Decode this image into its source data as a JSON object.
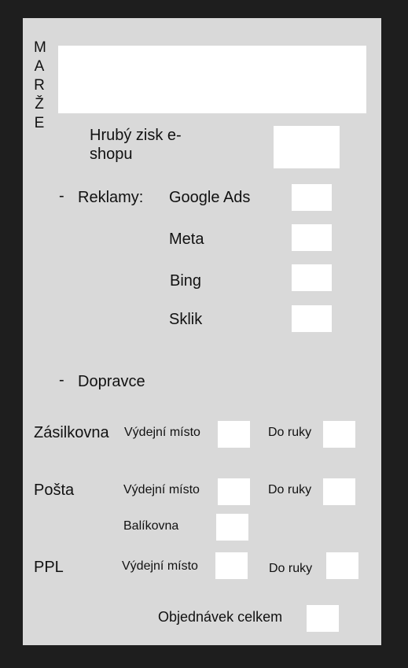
{
  "form": {
    "marze_letters": [
      "M",
      "A",
      "R",
      "Ž",
      "E"
    ],
    "hruby_zisk_line1": "Hrubý zisk e-",
    "hruby_zisk_line2": "shopu",
    "dash": "-",
    "reklamy_label": "Reklamy:",
    "ads": [
      "Google Ads",
      "Meta",
      "Bing",
      "Sklik"
    ],
    "dopravce_label": "Dopravce",
    "carriers": {
      "zasilkovna": {
        "name": "Zásilkovna",
        "vydejni": "Výdejní místo",
        "do_ruky": "Do ruky"
      },
      "posta": {
        "name": "Pošta",
        "vydejni": "Výdejní místo",
        "do_ruky": "Do ruky",
        "balikovna": "Balíkovna"
      },
      "ppl": {
        "name": "PPL",
        "vydejni": "Výdejní místo",
        "do_ruky": "Do ruky"
      }
    },
    "objednavek_label": "Objednávek celkem"
  },
  "colors": {
    "background": "#1e1e1e",
    "panel": "#d9d9d9",
    "input": "#ffffff",
    "text": "#111111"
  }
}
